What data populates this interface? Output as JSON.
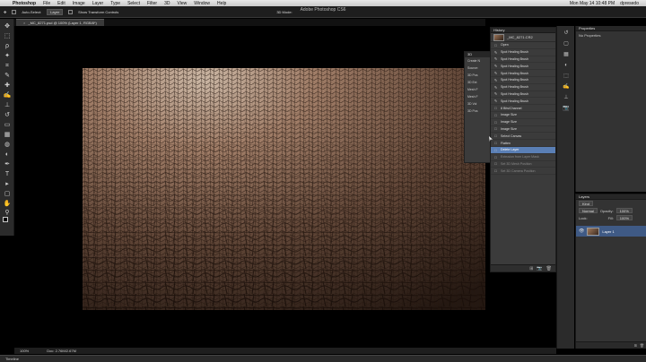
{
  "menubar": {
    "apple": "",
    "items": [
      "Photoshop",
      "File",
      "Edit",
      "Image",
      "Layer",
      "Type",
      "Select",
      "Filter",
      "3D",
      "View",
      "Window",
      "Help"
    ],
    "clock": "Mon May 14  10:48 PM",
    "user": "dpresedo"
  },
  "app_title": "Adobe Photoshop CS6",
  "options_bar": {
    "auto_select": "Auto-Select:",
    "auto_select_value": "Layer",
    "transform_controls": "Show Transform Controls",
    "mode_3d": "3D Mode:"
  },
  "document": {
    "tab_title": "_MC_8271.psd @ 100% (Layer 1, RGB/8*)",
    "close_glyph": "×"
  },
  "status": {
    "zoom": "100%",
    "doc_size": "Doc: 2.76M/2.67M"
  },
  "timeline": {
    "label": "Timeline"
  },
  "properties": {
    "title": "Properties",
    "subtitle": "No Properties"
  },
  "layers": {
    "title": "Layers",
    "kind_label": "Kind",
    "blend_mode": "Normal",
    "opacity_label": "Opacity:",
    "opacity_value": "100%",
    "lock_label": "Lock:",
    "fill_label": "Fill:",
    "fill_value": "100%",
    "layer_name": "Layer 1"
  },
  "panel_3d": {
    "title": "3D",
    "rows": [
      "Create N",
      "Source:",
      "3D Pos",
      "3D Ext",
      "Mesh F",
      "Mesh F",
      "3D Vol",
      "3D Pos"
    ]
  },
  "history": {
    "title": "History",
    "snapshot": "_MC_8271.CR2",
    "items": [
      {
        "icon": "□",
        "label": "Open",
        "state": "normal"
      },
      {
        "icon": "✎",
        "label": "Spot Healing Brush",
        "state": "normal"
      },
      {
        "icon": "✎",
        "label": "Spot Healing Brush",
        "state": "normal"
      },
      {
        "icon": "✎",
        "label": "Spot Healing Brush",
        "state": "normal"
      },
      {
        "icon": "✎",
        "label": "Spot Healing Brush",
        "state": "normal"
      },
      {
        "icon": "✎",
        "label": "Spot Healing Brush",
        "state": "normal"
      },
      {
        "icon": "✎",
        "label": "Spot Healing Brush",
        "state": "normal"
      },
      {
        "icon": "✎",
        "label": "Spot Healing Brush",
        "state": "normal"
      },
      {
        "icon": "✎",
        "label": "Spot Healing Brush",
        "state": "normal"
      },
      {
        "icon": "□",
        "label": "8 Bits/Channel",
        "state": "normal"
      },
      {
        "icon": "□",
        "label": "Image Size",
        "state": "normal"
      },
      {
        "icon": "□",
        "label": "Image Size",
        "state": "normal"
      },
      {
        "icon": "□",
        "label": "Image Size",
        "state": "normal"
      },
      {
        "icon": "□",
        "label": "Select Canvas",
        "state": "normal"
      },
      {
        "icon": "□",
        "label": "Flatten",
        "state": "normal"
      },
      {
        "icon": "□",
        "label": "Delete Layer",
        "state": "sel"
      },
      {
        "icon": "□",
        "label": "Extrusion from Layer Mask",
        "state": "dim"
      },
      {
        "icon": "□",
        "label": "Set 3D Mesh Position",
        "state": "dim"
      },
      {
        "icon": "□",
        "label": "Set 3D Camera Position",
        "state": "dim"
      }
    ]
  },
  "icons": {
    "move": "✥",
    "marquee": "⬚",
    "lasso": "ρ",
    "wand": "✦",
    "crop": "⌗",
    "eyedropper": "✎",
    "heal": "✚",
    "brush": "✍",
    "stamp": "⊥",
    "history_brush": "↺",
    "eraser": "▭",
    "gradient": "▦",
    "blur": "◍",
    "dodge": "◐",
    "pen": "✒",
    "type": "T",
    "path_select": "▸",
    "shape": "▢",
    "hand": "✋",
    "zoom": "⚲",
    "eye": "👁",
    "lock": "🔒",
    "trash": "🗑",
    "new": "⊞",
    "camera": "📷"
  }
}
